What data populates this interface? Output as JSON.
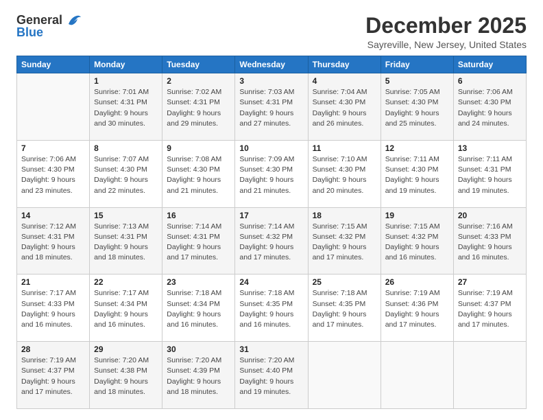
{
  "header": {
    "logo_line1": "General",
    "logo_line2": "Blue",
    "title": "December 2025",
    "subtitle": "Sayreville, New Jersey, United States"
  },
  "weekdays": [
    "Sunday",
    "Monday",
    "Tuesday",
    "Wednesday",
    "Thursday",
    "Friday",
    "Saturday"
  ],
  "weeks": [
    [
      {
        "day": "",
        "info": ""
      },
      {
        "day": "1",
        "info": "Sunrise: 7:01 AM\nSunset: 4:31 PM\nDaylight: 9 hours\nand 30 minutes."
      },
      {
        "day": "2",
        "info": "Sunrise: 7:02 AM\nSunset: 4:31 PM\nDaylight: 9 hours\nand 29 minutes."
      },
      {
        "day": "3",
        "info": "Sunrise: 7:03 AM\nSunset: 4:31 PM\nDaylight: 9 hours\nand 27 minutes."
      },
      {
        "day": "4",
        "info": "Sunrise: 7:04 AM\nSunset: 4:30 PM\nDaylight: 9 hours\nand 26 minutes."
      },
      {
        "day": "5",
        "info": "Sunrise: 7:05 AM\nSunset: 4:30 PM\nDaylight: 9 hours\nand 25 minutes."
      },
      {
        "day": "6",
        "info": "Sunrise: 7:06 AM\nSunset: 4:30 PM\nDaylight: 9 hours\nand 24 minutes."
      }
    ],
    [
      {
        "day": "7",
        "info": "Sunrise: 7:06 AM\nSunset: 4:30 PM\nDaylight: 9 hours\nand 23 minutes."
      },
      {
        "day": "8",
        "info": "Sunrise: 7:07 AM\nSunset: 4:30 PM\nDaylight: 9 hours\nand 22 minutes."
      },
      {
        "day": "9",
        "info": "Sunrise: 7:08 AM\nSunset: 4:30 PM\nDaylight: 9 hours\nand 21 minutes."
      },
      {
        "day": "10",
        "info": "Sunrise: 7:09 AM\nSunset: 4:30 PM\nDaylight: 9 hours\nand 21 minutes."
      },
      {
        "day": "11",
        "info": "Sunrise: 7:10 AM\nSunset: 4:30 PM\nDaylight: 9 hours\nand 20 minutes."
      },
      {
        "day": "12",
        "info": "Sunrise: 7:11 AM\nSunset: 4:30 PM\nDaylight: 9 hours\nand 19 minutes."
      },
      {
        "day": "13",
        "info": "Sunrise: 7:11 AM\nSunset: 4:31 PM\nDaylight: 9 hours\nand 19 minutes."
      }
    ],
    [
      {
        "day": "14",
        "info": "Sunrise: 7:12 AM\nSunset: 4:31 PM\nDaylight: 9 hours\nand 18 minutes."
      },
      {
        "day": "15",
        "info": "Sunrise: 7:13 AM\nSunset: 4:31 PM\nDaylight: 9 hours\nand 18 minutes."
      },
      {
        "day": "16",
        "info": "Sunrise: 7:14 AM\nSunset: 4:31 PM\nDaylight: 9 hours\nand 17 minutes."
      },
      {
        "day": "17",
        "info": "Sunrise: 7:14 AM\nSunset: 4:32 PM\nDaylight: 9 hours\nand 17 minutes."
      },
      {
        "day": "18",
        "info": "Sunrise: 7:15 AM\nSunset: 4:32 PM\nDaylight: 9 hours\nand 17 minutes."
      },
      {
        "day": "19",
        "info": "Sunrise: 7:15 AM\nSunset: 4:32 PM\nDaylight: 9 hours\nand 16 minutes."
      },
      {
        "day": "20",
        "info": "Sunrise: 7:16 AM\nSunset: 4:33 PM\nDaylight: 9 hours\nand 16 minutes."
      }
    ],
    [
      {
        "day": "21",
        "info": "Sunrise: 7:17 AM\nSunset: 4:33 PM\nDaylight: 9 hours\nand 16 minutes."
      },
      {
        "day": "22",
        "info": "Sunrise: 7:17 AM\nSunset: 4:34 PM\nDaylight: 9 hours\nand 16 minutes."
      },
      {
        "day": "23",
        "info": "Sunrise: 7:18 AM\nSunset: 4:34 PM\nDaylight: 9 hours\nand 16 minutes."
      },
      {
        "day": "24",
        "info": "Sunrise: 7:18 AM\nSunset: 4:35 PM\nDaylight: 9 hours\nand 16 minutes."
      },
      {
        "day": "25",
        "info": "Sunrise: 7:18 AM\nSunset: 4:35 PM\nDaylight: 9 hours\nand 17 minutes."
      },
      {
        "day": "26",
        "info": "Sunrise: 7:19 AM\nSunset: 4:36 PM\nDaylight: 9 hours\nand 17 minutes."
      },
      {
        "day": "27",
        "info": "Sunrise: 7:19 AM\nSunset: 4:37 PM\nDaylight: 9 hours\nand 17 minutes."
      }
    ],
    [
      {
        "day": "28",
        "info": "Sunrise: 7:19 AM\nSunset: 4:37 PM\nDaylight: 9 hours\nand 17 minutes."
      },
      {
        "day": "29",
        "info": "Sunrise: 7:20 AM\nSunset: 4:38 PM\nDaylight: 9 hours\nand 18 minutes."
      },
      {
        "day": "30",
        "info": "Sunrise: 7:20 AM\nSunset: 4:39 PM\nDaylight: 9 hours\nand 18 minutes."
      },
      {
        "day": "31",
        "info": "Sunrise: 7:20 AM\nSunset: 4:40 PM\nDaylight: 9 hours\nand 19 minutes."
      },
      {
        "day": "",
        "info": ""
      },
      {
        "day": "",
        "info": ""
      },
      {
        "day": "",
        "info": ""
      }
    ]
  ]
}
